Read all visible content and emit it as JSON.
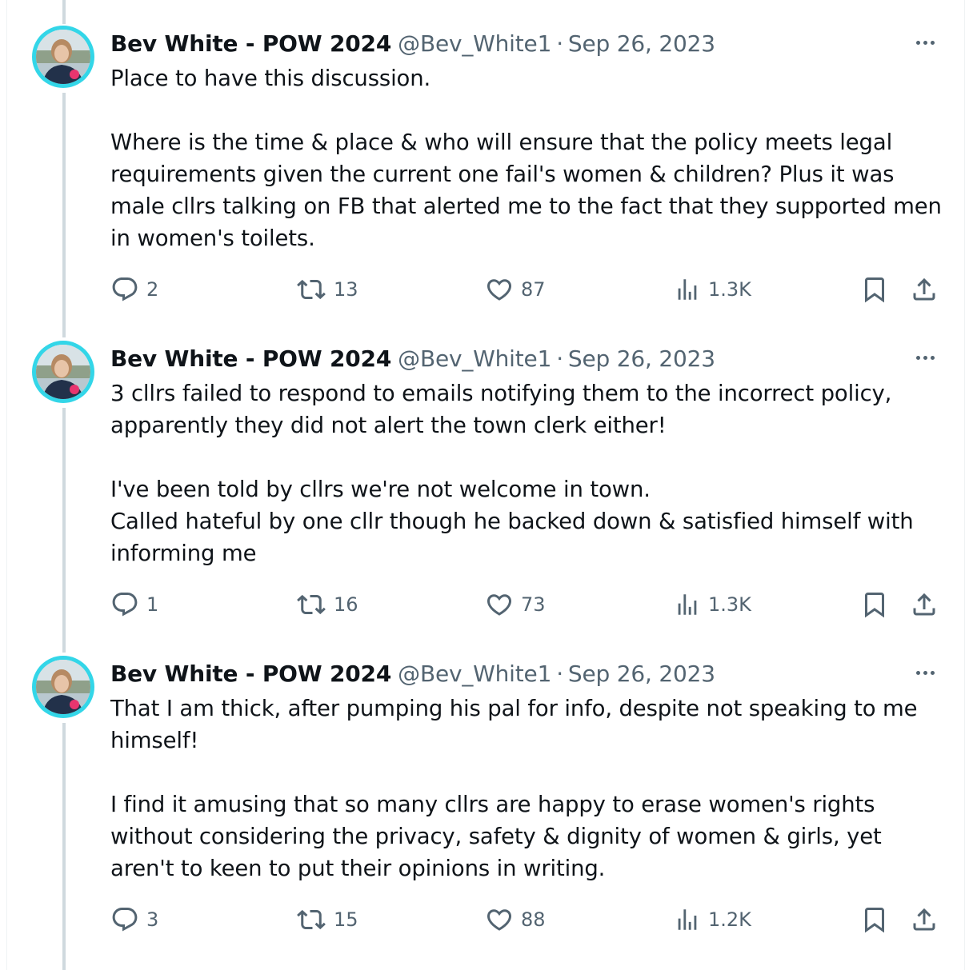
{
  "tweets": [
    {
      "name": "Bev White - POW 2024",
      "handle": "@Bev_White1",
      "separator": "·",
      "date": "Sep 26, 2023",
      "text": "Place to have this discussion.\n\nWhere is the time & place & who will ensure that the policy meets legal requirements given the current one fail's women & children? Plus it was male cllrs talking on FB that alerted me to the fact that they supported men in women's toilets.",
      "replies": "2",
      "reposts": "13",
      "likes": "87",
      "views": "1.3K"
    },
    {
      "name": "Bev White - POW 2024",
      "handle": "@Bev_White1",
      "separator": "·",
      "date": "Sep 26, 2023",
      "text": "3 cllrs failed to respond to emails notifying them to the incorrect policy, apparently they did not alert the town clerk either!\n\nI've been told by cllrs we're not welcome in town.\nCalled hateful by one cllr though he backed down & satisfied himself with informing me",
      "replies": "1",
      "reposts": "16",
      "likes": "73",
      "views": "1.3K"
    },
    {
      "name": "Bev White - POW 2024",
      "handle": "@Bev_White1",
      "separator": "·",
      "date": "Sep 26, 2023",
      "text": "That I am thick, after pumping his pal for info, despite not speaking to me himself!\n\nI find it amusing that so many cllrs are happy to erase women's rights without considering the privacy, safety & dignity of women & girls, yet aren't to keen to put their opinions in writing.",
      "replies": "3",
      "reposts": "15",
      "likes": "88",
      "views": "1.2K"
    }
  ],
  "icons": {
    "reply": "reply-icon",
    "repost": "repost-icon",
    "like": "like-icon",
    "views": "views-icon",
    "bookmark": "bookmark-icon",
    "share": "share-icon",
    "more": "more-icon"
  },
  "colors": {
    "text": "#0f1419",
    "secondary": "#536471",
    "thread_line": "#cfd9de",
    "avatar_ring": "#33d6e8",
    "badge": "#e8356f"
  }
}
